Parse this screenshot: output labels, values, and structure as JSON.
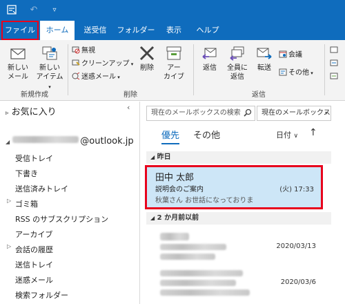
{
  "tabs": [
    {
      "label": "ファイル"
    },
    {
      "label": "ホーム"
    },
    {
      "label": "送受信"
    },
    {
      "label": "フォルダー"
    },
    {
      "label": "表示"
    },
    {
      "label": "ヘルプ"
    }
  ],
  "ribbon": {
    "new_mail": "新しい\nメール",
    "new_items": "新しい\nアイテム",
    "new_group": "新規作成",
    "ignore": "無視",
    "cleanup": "クリーンアップ",
    "junk": "迷惑メール",
    "delete": "削除",
    "archive": "アー\nカイブ",
    "delete_group": "削除",
    "reply": "返信",
    "reply_all": "全員に\n返信",
    "forward": "転送",
    "meeting": "会議",
    "more": "その他",
    "respond_group": "返信"
  },
  "folders": {
    "favorites": "お気に入り",
    "account_suffix": "@outlook.jp",
    "items": [
      {
        "label": "受信トレイ"
      },
      {
        "label": "下書き"
      },
      {
        "label": "送信済みトレイ"
      },
      {
        "label": "ゴミ箱"
      },
      {
        "label": "RSS のサブスクリプション"
      },
      {
        "label": "アーカイブ"
      },
      {
        "label": "会話の履歴"
      },
      {
        "label": "送信トレイ"
      },
      {
        "label": "迷惑メール"
      },
      {
        "label": "検索フォルダー"
      }
    ]
  },
  "mail": {
    "search_placeholder": "現在のメールボックスの検索",
    "scope": "現在のメールボックス",
    "tab_focused": "優先",
    "tab_other": "その他",
    "sort": "日付",
    "group_yesterday": "昨日",
    "group_older": "2 か月前以前",
    "items": [
      {
        "from": "田中 太郎",
        "subject": "説明会のご案内",
        "preview": "秋葉さん お世話になっておりま",
        "date": "(火) 17:33"
      },
      {
        "date": "2020/03/13"
      },
      {
        "date": "2020/03/6"
      }
    ]
  },
  "colors": {
    "accent": "#0f6cbd",
    "highlight": "#e8001c",
    "selected": "#cde6f7"
  }
}
